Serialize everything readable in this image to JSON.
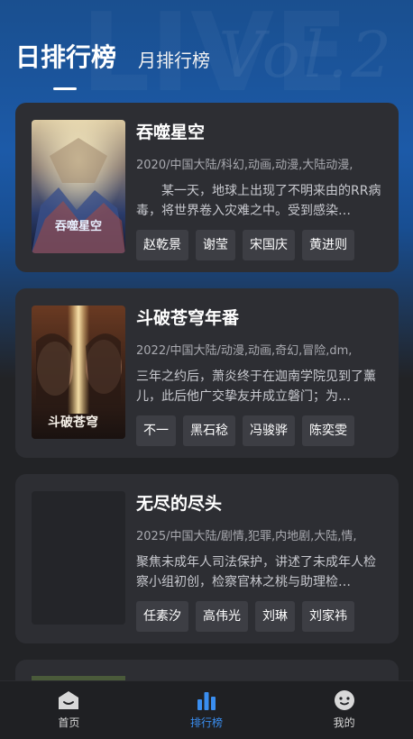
{
  "tabs": {
    "day_label": "日排行榜",
    "month_label": "月排行榜"
  },
  "items": [
    {
      "title": "吞噬星空",
      "meta": "2020/中国大陆/科幻,动画,动漫,大陆动漫,",
      "description": "某一天，地球上出现了不明来由的RR病毒，将世界卷入灾难之中。受到感染…",
      "tags": [
        "赵乾景",
        "谢莹",
        "宋国庆",
        "黄进则"
      ],
      "poster_text": "吞噬星空"
    },
    {
      "title": "斗破苍穹年番",
      "meta": "2022/中国大陆/动漫,动画,奇幻,冒险,dm,",
      "description": "三年之约后，萧炎终于在迦南学院见到了薰儿，此后他广交挚友并成立磐门；为…",
      "tags": [
        "不一",
        "黑石稔",
        "冯骏骅",
        "陈奕雯"
      ],
      "poster_text": "斗破苍穹"
    },
    {
      "title": "无尽的尽头",
      "meta": "2025/中国大陆/剧情,犯罪,内地剧,大陆,情,",
      "description": "聚焦未成年人司法保护，讲述了未成年人检察小组初创，检察官林之桃与助理检…",
      "tags": [
        "任素汐",
        "高伟光",
        "刘琳",
        "刘家祎"
      ],
      "poster_text": ""
    }
  ],
  "bottom_nav": [
    {
      "label": "首页",
      "icon": "home-icon",
      "active": false
    },
    {
      "label": "排行榜",
      "icon": "ranking-icon",
      "active": true
    },
    {
      "label": "我的",
      "icon": "profile-icon",
      "active": false
    }
  ],
  "colors": {
    "accent": "#3a8ef0",
    "card_bg": "#2d2e33",
    "page_bg": "#222326"
  }
}
